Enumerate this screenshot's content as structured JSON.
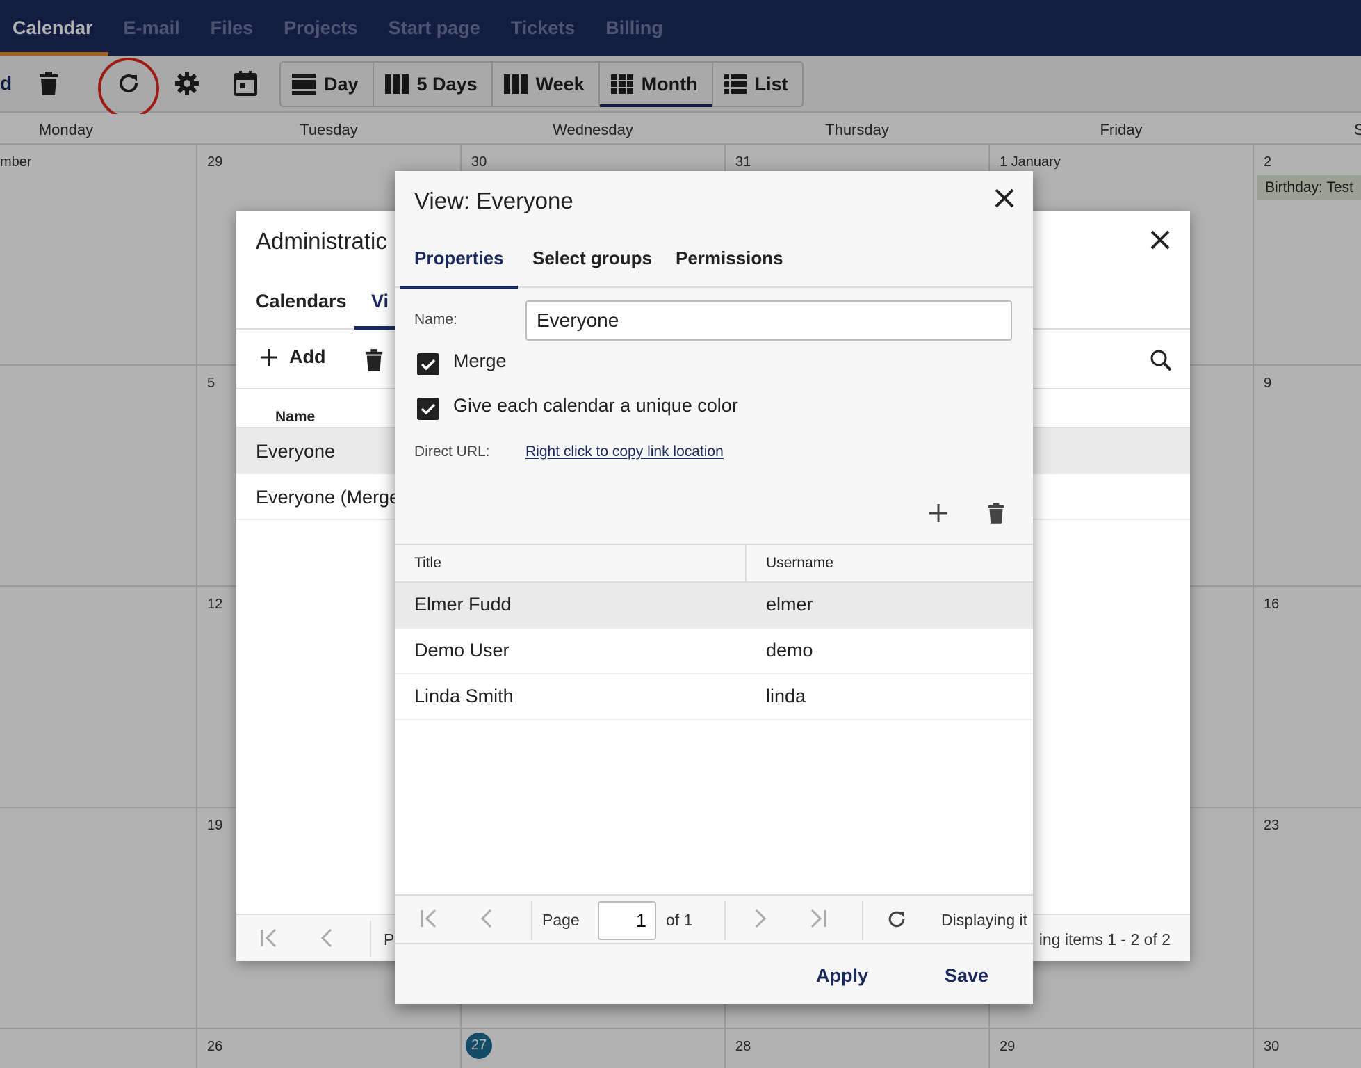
{
  "topnav": {
    "tabs": [
      "Calendar",
      "E-mail",
      "Files",
      "Projects",
      "Start page",
      "Tickets",
      "Billing"
    ]
  },
  "toolbar": {
    "edge_text": "d",
    "views": [
      "Day",
      "5 Days",
      "Week",
      "Month",
      "List"
    ],
    "active_view": "Month"
  },
  "calendar": {
    "days": [
      "Monday",
      "Tuesday",
      "Wednesday",
      "Thursday",
      "Friday",
      "S"
    ],
    "weeks": [
      [
        "mber",
        "29",
        "30",
        "31",
        "1 January",
        "2"
      ],
      [
        "",
        "5",
        "",
        "",
        "",
        "9"
      ],
      [
        "",
        "12",
        "",
        "",
        "",
        "16"
      ],
      [
        "",
        "19",
        "",
        "",
        "",
        "23"
      ],
      [
        "",
        "26",
        "27",
        "28",
        "29",
        "30"
      ]
    ],
    "event": "Birthday: Test",
    "today": "27"
  },
  "admin_dialog": {
    "title": "Administratic",
    "tabs": [
      "Calendars",
      "Vi"
    ],
    "add_label": "Add",
    "column_name": "Name",
    "rows": [
      "Everyone",
      "Everyone (Merge"
    ],
    "pager_label": "P",
    "display_text": "ing items 1 - 2 of 2"
  },
  "view_dialog": {
    "title": "View: Everyone",
    "tabs": [
      "Properties",
      "Select groups",
      "Permissions"
    ],
    "name_label": "Name:",
    "name_value": "Everyone",
    "merge_label": "Merge",
    "unique_color_label": "Give each calendar a unique color",
    "direct_url_label": "Direct URL:",
    "direct_url_link": "Right click to copy link location",
    "columns": [
      "Title",
      "Username"
    ],
    "members": [
      {
        "title": "Elmer Fudd",
        "username": "elmer"
      },
      {
        "title": "Demo User",
        "username": "demo"
      },
      {
        "title": "Linda Smith",
        "username": "linda"
      }
    ],
    "pager": {
      "page_label": "Page",
      "page_value": "1",
      "of_label": "of 1",
      "display_text": "Displaying it"
    },
    "apply_label": "Apply",
    "save_label": "Save"
  }
}
